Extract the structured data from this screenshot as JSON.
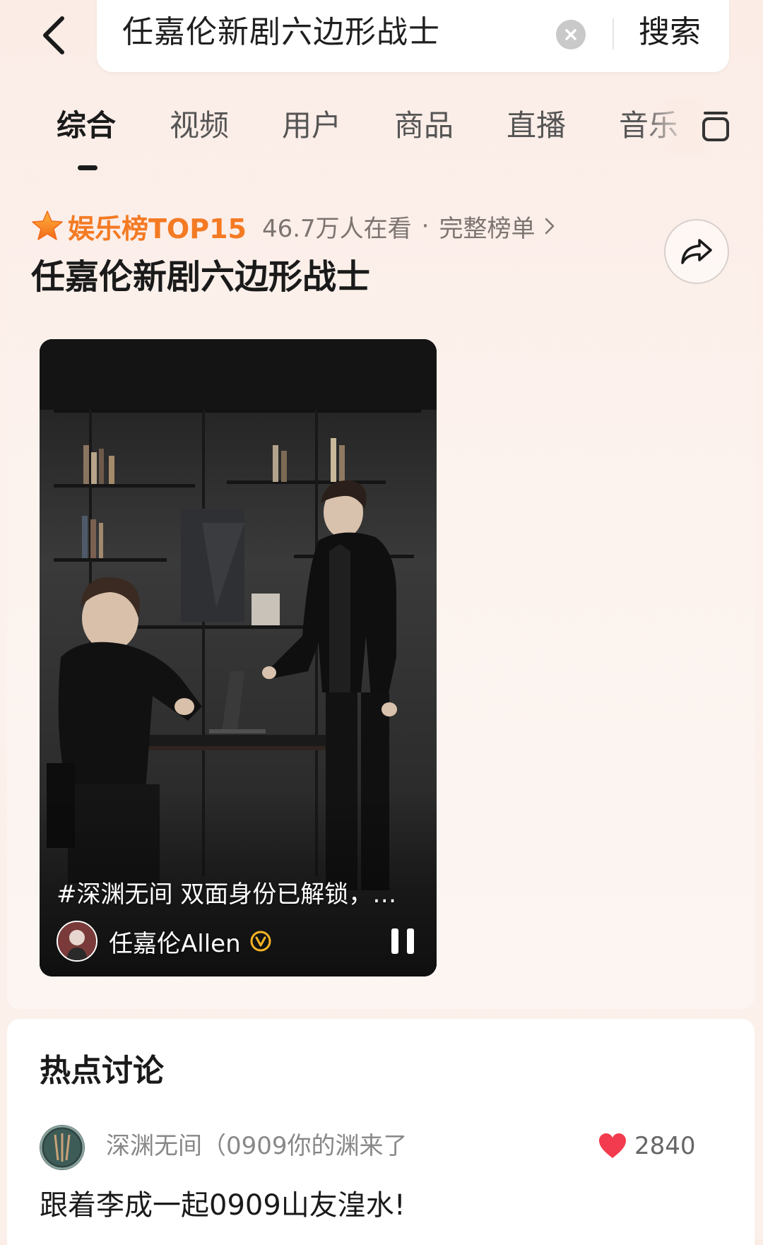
{
  "search": {
    "query": "任嘉伦新剧六边形战士",
    "submit_label": "搜索"
  },
  "tabs": [
    {
      "label": "综合",
      "active": true
    },
    {
      "label": "视频",
      "active": false
    },
    {
      "label": "用户",
      "active": false
    },
    {
      "label": "商品",
      "active": false
    },
    {
      "label": "直播",
      "active": false
    },
    {
      "label": "音乐",
      "active": false
    }
  ],
  "hot_list": {
    "rank_label": "娱乐榜TOP15",
    "viewers": "46.7万人在看",
    "separator": "·",
    "full_list_label": "完整榜单",
    "topic_title": "任嘉伦新剧六边形战士"
  },
  "video": {
    "caption": "#深渊无间 双面身份已解锁，…",
    "author_name": "任嘉伦Allen"
  },
  "discussion": {
    "title": "热点讨论",
    "comment": {
      "user": "深渊无间（0909你的渊来了",
      "likes": "2840",
      "text": "跟着李成一起0909山友湟水!"
    }
  },
  "colors": {
    "accent_orange": "#f47a23",
    "like_red": "#f23b4e",
    "background": "#fbece6"
  },
  "icons": [
    "back-arrow-icon",
    "clear-icon",
    "more-tabs-icon",
    "star-icon",
    "chevron-right-icon",
    "share-icon",
    "verified-icon",
    "pause-icon",
    "heart-icon"
  ]
}
